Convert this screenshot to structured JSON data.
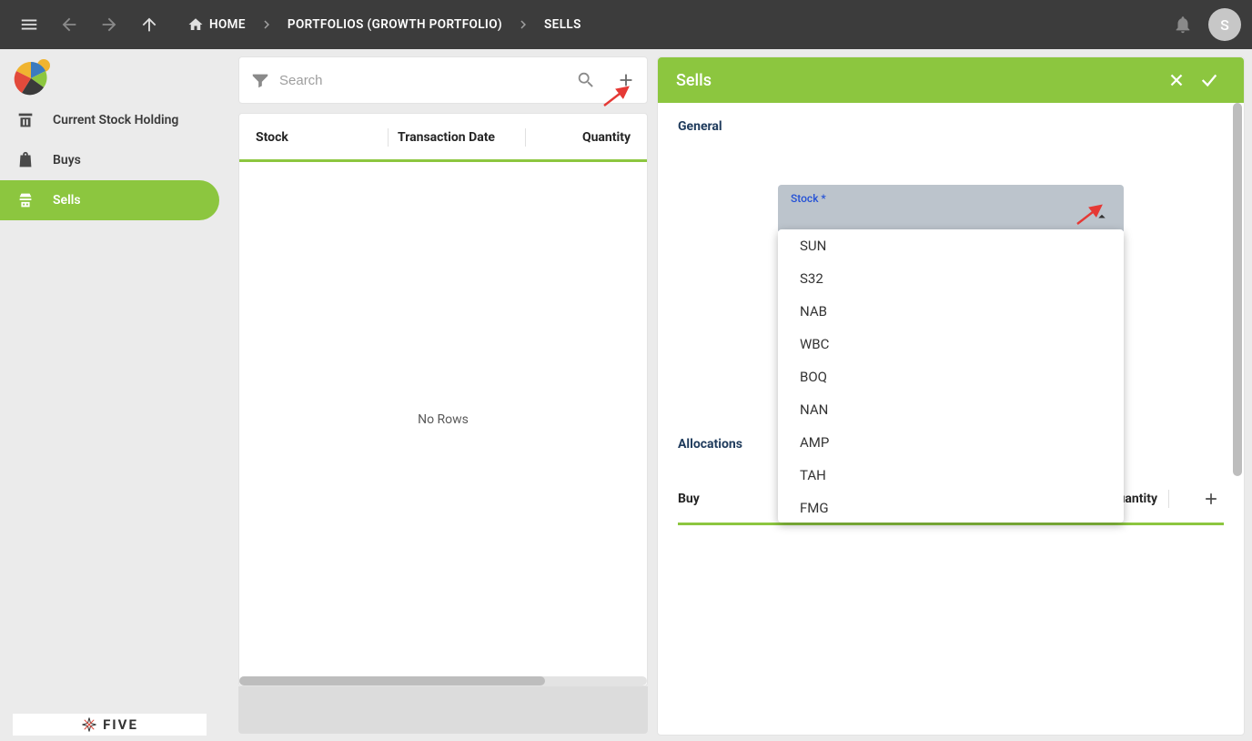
{
  "topbar": {
    "home": "HOME",
    "breadcrumb1": "PORTFOLIOS (GROWTH PORTFOLIO)",
    "breadcrumb2": "SELLS",
    "avatar_letter": "S"
  },
  "sidebar": {
    "items": [
      {
        "label": "Current Stock Holding",
        "icon": "holding",
        "active": false
      },
      {
        "label": "Buys",
        "icon": "buy",
        "active": false
      },
      {
        "label": "Sells",
        "icon": "sell",
        "active": true
      }
    ],
    "footer": "FIVE"
  },
  "list": {
    "search_placeholder": "Search",
    "columns": {
      "stock": "Stock",
      "date": "Transaction Date",
      "qty": "Quantity"
    },
    "empty": "No Rows"
  },
  "detail": {
    "title": "Sells",
    "section_general": "General",
    "stock_label": "Stock *",
    "stock_value": "",
    "stock_options": [
      "SUN",
      "S32",
      "NAB",
      "WBC",
      "BOQ",
      "NAN",
      "AMP",
      "TAH",
      "FMG"
    ],
    "section_alloc": "Allocations",
    "alloc_buy": "Buy",
    "alloc_qty": "Quantity"
  }
}
